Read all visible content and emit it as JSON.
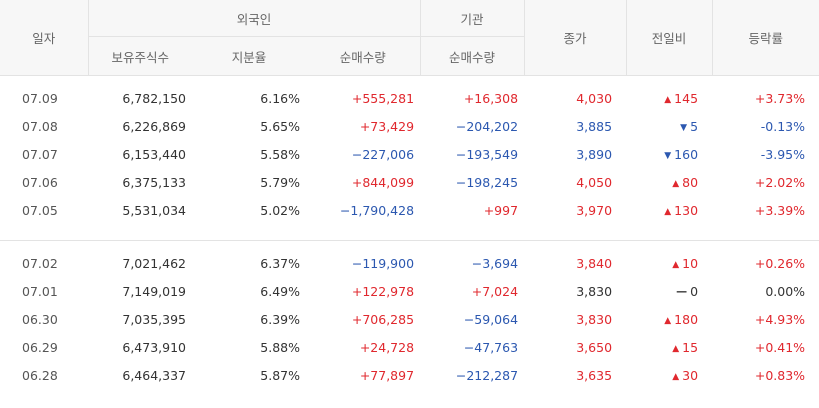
{
  "headers": {
    "date": "일자",
    "foreign": "외국인",
    "institution": "기관",
    "holding": "보유주식수",
    "share": "지분율",
    "foreign_net": "순매수량",
    "inst_net": "순매수량",
    "close": "종가",
    "change": "전일비",
    "rate": "등락률"
  },
  "icons": {
    "up": "triangle-up-icon",
    "down": "triangle-down-icon",
    "flat": "dash-icon"
  },
  "colors": {
    "up": "#e0282e",
    "down": "#2c58b0",
    "flat": "#333333"
  },
  "groups": [
    [
      {
        "date": "07.09",
        "holding": "6,782,150",
        "share": "6.16%",
        "fnet": "+555,281",
        "fnet_dir": "up",
        "inet": "+16,308",
        "inet_dir": "up",
        "close": "4,030",
        "close_dir": "up",
        "change": "145",
        "change_dir": "up",
        "rate": "+3.73%",
        "rate_dir": "up"
      },
      {
        "date": "07.08",
        "holding": "6,226,869",
        "share": "5.65%",
        "fnet": "+73,429",
        "fnet_dir": "up",
        "inet": "−204,202",
        "inet_dir": "down",
        "close": "3,885",
        "close_dir": "down",
        "change": "5",
        "change_dir": "down",
        "rate": "-0.13%",
        "rate_dir": "down"
      },
      {
        "date": "07.07",
        "holding": "6,153,440",
        "share": "5.58%",
        "fnet": "−227,006",
        "fnet_dir": "down",
        "inet": "−193,549",
        "inet_dir": "down",
        "close": "3,890",
        "close_dir": "down",
        "change": "160",
        "change_dir": "down",
        "rate": "-3.95%",
        "rate_dir": "down"
      },
      {
        "date": "07.06",
        "holding": "6,375,133",
        "share": "5.79%",
        "fnet": "+844,099",
        "fnet_dir": "up",
        "inet": "−198,245",
        "inet_dir": "down",
        "close": "4,050",
        "close_dir": "up",
        "change": "80",
        "change_dir": "up",
        "rate": "+2.02%",
        "rate_dir": "up"
      },
      {
        "date": "07.05",
        "holding": "5,531,034",
        "share": "5.02%",
        "fnet": "−1,790,428",
        "fnet_dir": "down",
        "inet": "+997",
        "inet_dir": "up",
        "close": "3,970",
        "close_dir": "up",
        "change": "130",
        "change_dir": "up",
        "rate": "+3.39%",
        "rate_dir": "up"
      }
    ],
    [
      {
        "date": "07.02",
        "holding": "7,021,462",
        "share": "6.37%",
        "fnet": "−119,900",
        "fnet_dir": "down",
        "inet": "−3,694",
        "inet_dir": "down",
        "close": "3,840",
        "close_dir": "up",
        "change": "10",
        "change_dir": "up",
        "rate": "+0.26%",
        "rate_dir": "up"
      },
      {
        "date": "07.01",
        "holding": "7,149,019",
        "share": "6.49%",
        "fnet": "+122,978",
        "fnet_dir": "up",
        "inet": "+7,024",
        "inet_dir": "up",
        "close": "3,830",
        "close_dir": "flat",
        "change": "0",
        "change_dir": "flat",
        "rate": "0.00%",
        "rate_dir": "flat"
      },
      {
        "date": "06.30",
        "holding": "7,035,395",
        "share": "6.39%",
        "fnet": "+706,285",
        "fnet_dir": "up",
        "inet": "−59,064",
        "inet_dir": "down",
        "close": "3,830",
        "close_dir": "up",
        "change": "180",
        "change_dir": "up",
        "rate": "+4.93%",
        "rate_dir": "up"
      },
      {
        "date": "06.29",
        "holding": "6,473,910",
        "share": "5.88%",
        "fnet": "+24,728",
        "fnet_dir": "up",
        "inet": "−47,763",
        "inet_dir": "down",
        "close": "3,650",
        "close_dir": "up",
        "change": "15",
        "change_dir": "up",
        "rate": "+0.41%",
        "rate_dir": "up"
      },
      {
        "date": "06.28",
        "holding": "6,464,337",
        "share": "5.87%",
        "fnet": "+77,897",
        "fnet_dir": "up",
        "inet": "−212,287",
        "inet_dir": "down",
        "close": "3,635",
        "close_dir": "up",
        "change": "30",
        "change_dir": "up",
        "rate": "+0.83%",
        "rate_dir": "up"
      }
    ]
  ]
}
